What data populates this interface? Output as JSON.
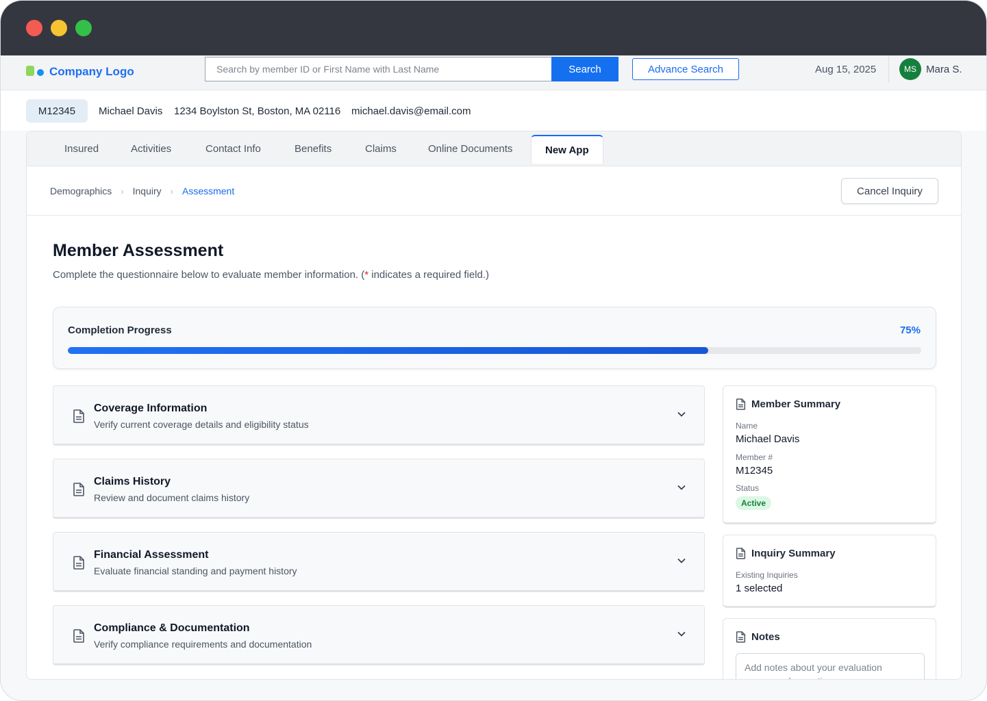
{
  "header": {
    "logo_text": "Company Logo",
    "search_placeholder": "Search by member ID or First Name with Last Name",
    "search_button": "Search",
    "advance_search_button": "Advance Search",
    "date": "Aug 15, 2025",
    "user_initials": "MS",
    "user_name": "Mara S."
  },
  "member": {
    "id": "M12345",
    "name": "Michael Davis",
    "address": "1234 Boylston St, Boston, MA 02116",
    "email": "michael.davis@email.com"
  },
  "tabs": [
    {
      "label": "Insured"
    },
    {
      "label": "Activities"
    },
    {
      "label": "Contact Info"
    },
    {
      "label": "Benefits"
    },
    {
      "label": "Claims"
    },
    {
      "label": "Online Documents"
    },
    {
      "label": "New App",
      "active": true
    }
  ],
  "breadcrumb": [
    "Demographics",
    "Inquiry",
    "Assessment"
  ],
  "cancel_button": "Cancel Inquiry",
  "page": {
    "title": "Member Assessment",
    "subtitle_before": "Complete the questionnaire below to evaluate member information. (",
    "required_mark": "*",
    "subtitle_after": " indicates a required field.)"
  },
  "progress": {
    "label": "Completion Progress",
    "percent_text": "75%",
    "value": 0.75
  },
  "sections": [
    {
      "title": "Coverage Information",
      "subtitle": "Verify current coverage details and eligibility status"
    },
    {
      "title": "Claims History",
      "subtitle": "Review and document claims history"
    },
    {
      "title": "Financial Assessment",
      "subtitle": "Evaluate financial standing and payment history"
    },
    {
      "title": "Compliance & Documentation",
      "subtitle": "Verify compliance requirements and documentation"
    }
  ],
  "member_summary": {
    "title": "Member Summary",
    "name_label": "Name",
    "name_value": "Michael Davis",
    "number_label": "Member #",
    "number_value": "M12345",
    "status_label": "Status",
    "status_value": "Active"
  },
  "inquiry_summary": {
    "title": "Inquiry Summary",
    "existing_label": "Existing Inquiries",
    "existing_value": "1 selected"
  },
  "notes": {
    "title": "Notes",
    "placeholder": "Add notes about your evaluation process, observations, or any"
  },
  "colors": {
    "accent": "#1a6bf0",
    "titlebar": "#353740",
    "status_active": "#15803d"
  }
}
